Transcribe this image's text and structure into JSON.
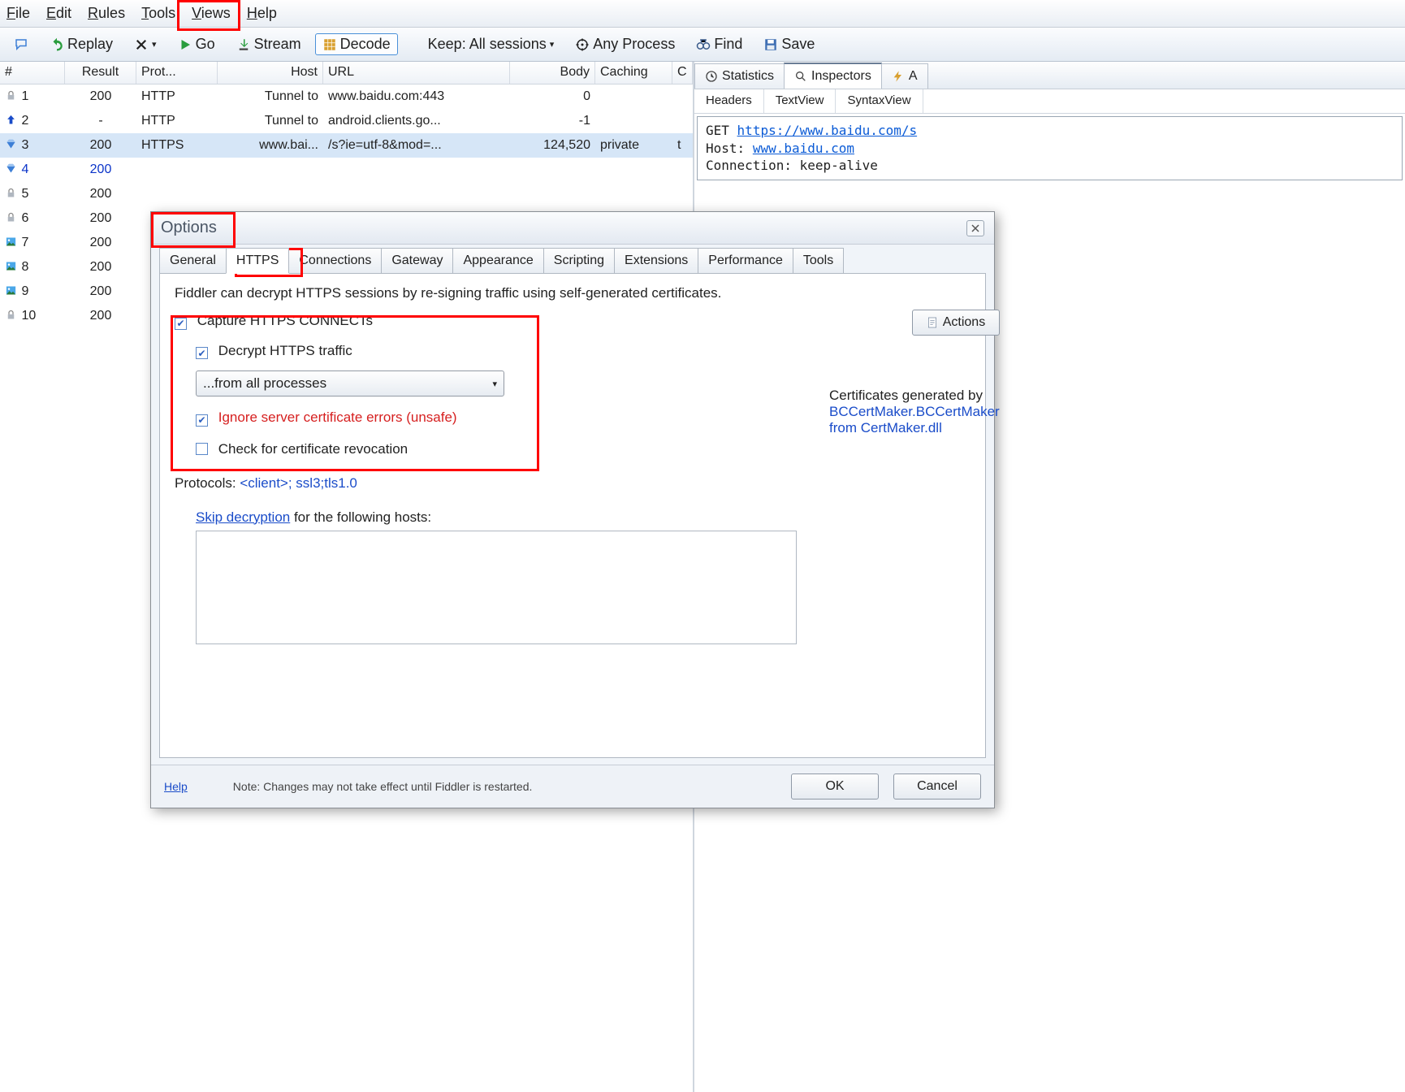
{
  "menu": {
    "file": "File",
    "edit": "Edit",
    "rules": "Rules",
    "tools": "Tools",
    "views": "Views",
    "help": "Help"
  },
  "toolbar": {
    "replay": "Replay",
    "go": "Go",
    "stream": "Stream",
    "decode": "Decode",
    "keep": "Keep: All sessions",
    "anyprocess": "Any Process",
    "find": "Find",
    "save": "Save"
  },
  "session_cols": [
    "#",
    "Result",
    "Prot...",
    "Host",
    "URL",
    "Body",
    "Caching",
    "C"
  ],
  "sessions": [
    {
      "icon": "lock",
      "n": "1",
      "res": "200",
      "pro": "HTTP",
      "host": "Tunnel to",
      "url": "www.baidu.com:443",
      "body": "0",
      "cache": "",
      "cc": ""
    },
    {
      "icon": "up",
      "n": "2",
      "res": "-",
      "pro": "HTTP",
      "host": "Tunnel to",
      "url": "android.clients.go...",
      "body": "-1",
      "cache": "",
      "cc": ""
    },
    {
      "icon": "diamond",
      "n": "3",
      "res": "200",
      "pro": "HTTPS",
      "host": "www.bai...",
      "url": "/s?ie=utf-8&mod=...",
      "body": "124,520",
      "cache": "private",
      "cc": "t",
      "sel": true
    },
    {
      "icon": "diamond",
      "n": "4",
      "res": "200",
      "pro": "",
      "host": "",
      "url": "",
      "body": "",
      "cache": "",
      "cc": "",
      "blue": true
    },
    {
      "icon": "lock",
      "n": "5",
      "res": "200",
      "pro": "",
      "host": "",
      "url": "",
      "body": "",
      "cache": "",
      "cc": ""
    },
    {
      "icon": "lock",
      "n": "6",
      "res": "200",
      "pro": "",
      "host": "",
      "url": "",
      "body": "",
      "cache": "",
      "cc": ""
    },
    {
      "icon": "img",
      "n": "7",
      "res": "200",
      "pro": "",
      "host": "",
      "url": "",
      "body": "",
      "cache": "",
      "cc": ""
    },
    {
      "icon": "img",
      "n": "8",
      "res": "200",
      "pro": "",
      "host": "",
      "url": "",
      "body": "",
      "cache": "",
      "cc": ""
    },
    {
      "icon": "img",
      "n": "9",
      "res": "200",
      "pro": "",
      "host": "",
      "url": "",
      "body": "",
      "cache": "",
      "cc": ""
    },
    {
      "icon": "lock",
      "n": "10",
      "res": "200",
      "pro": "",
      "host": "",
      "url": "",
      "body": "",
      "cache": "",
      "cc": ""
    }
  ],
  "right_tabs": {
    "stats": "Statistics",
    "inspectors": "Inspectors",
    "auto": "A"
  },
  "subtabs": [
    "Headers",
    "TextView",
    "SyntaxView"
  ],
  "raw": {
    "method": "GET",
    "url": "https://www.baidu.com/s",
    "host_label": "Host:",
    "host": "www.baidu.com",
    "conn": "Connection: keep-alive"
  },
  "dlg": {
    "title": "Options",
    "tabs": [
      "General",
      "HTTPS",
      "Connections",
      "Gateway",
      "Appearance",
      "Scripting",
      "Extensions",
      "Performance",
      "Tools"
    ],
    "intro": "Fiddler can decrypt HTTPS sessions by re-signing traffic using self-generated certificates.",
    "capture": "Capture HTTPS CONNECTs",
    "decrypt": "Decrypt HTTPS traffic",
    "from": "...from all processes",
    "ignore": "Ignore server certificate errors (unsafe)",
    "revoc": "Check for certificate revocation",
    "proto_label": "Protocols: ",
    "proto_value": "<client>; ssl3;tls1.0",
    "skip": "Skip decryption",
    "skip_after": " for the following hosts:",
    "certgen": "Certificates generated by ",
    "certgen_link": "BCCertMaker.BCCertMaker from CertMaker.dll",
    "actions": "Actions",
    "help": "Help",
    "note": "Note: Changes may not take effect until Fiddler is restarted.",
    "ok": "OK",
    "cancel": "Cancel"
  }
}
